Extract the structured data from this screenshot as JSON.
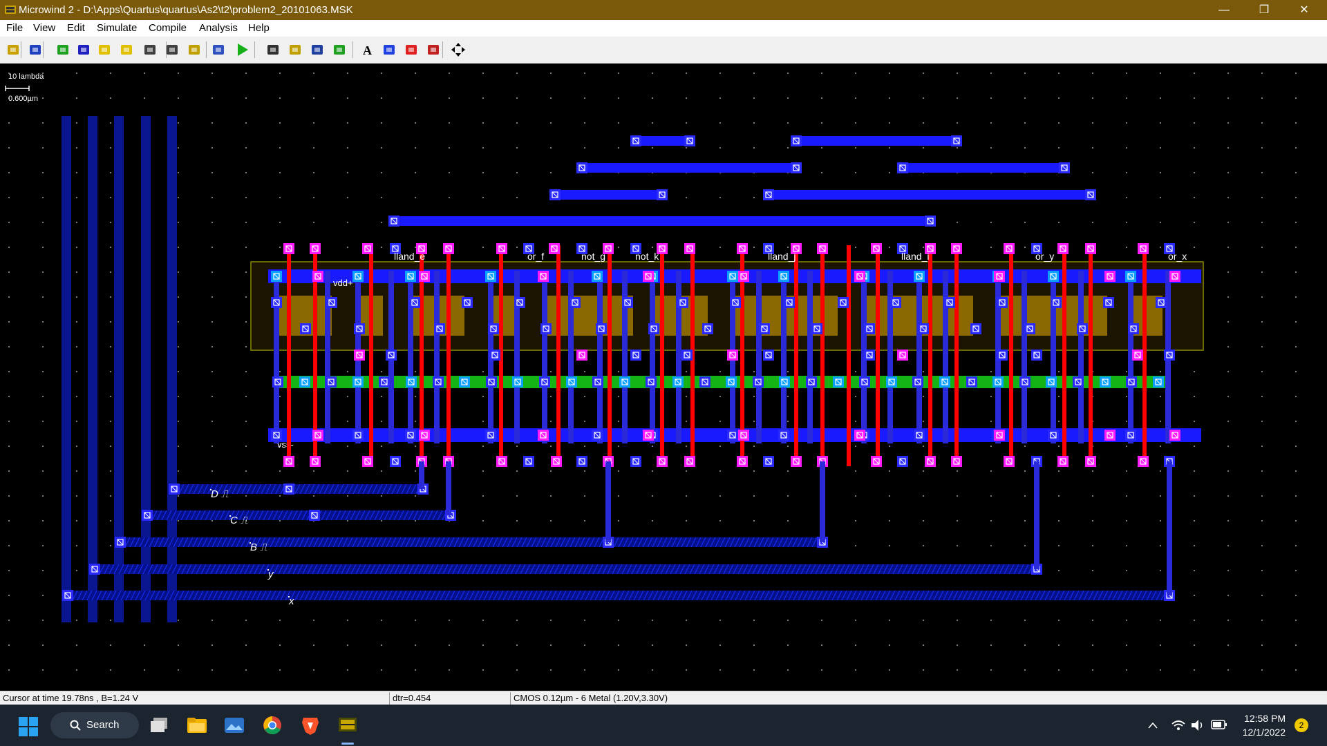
{
  "window": {
    "title": "Microwind 2 - D:\\Apps\\Quartus\\quartus\\As2\\t2\\problem2_20101063.MSK",
    "minimize_glyph": "—",
    "maximize_glyph": "❐",
    "close_glyph": "✕"
  },
  "menu": [
    "File",
    "View",
    "Edit",
    "Simulate",
    "Compile",
    "Analysis",
    "Help"
  ],
  "toolbar_icons": [
    "open-file-icon",
    "save-icon",
    "edit-icon",
    "layer-icon",
    "copy-icon",
    "move-icon",
    "zoom-in-icon",
    "zoom-out-icon",
    "zoom-all-icon",
    "connect-icon",
    "run-simulation-icon",
    "distance-icon",
    "mos-icon",
    "3d-view-icon",
    "chip-icon",
    "text-icon",
    "cross-section-icon",
    "curve-icon",
    "palette-icon",
    "navigate-icon"
  ],
  "scale": {
    "label": "10 lambda",
    "value": "0.600µm"
  },
  "layout": {
    "rail_labels": [
      "vdd+",
      "vss-"
    ],
    "cell_labels": [
      "lland_e",
      "or_f",
      "not_g",
      "not_k",
      "lland_j",
      "lland_i",
      "or_y",
      "or_x"
    ],
    "input_labels": [
      "D",
      "C",
      "B",
      "y",
      "x"
    ]
  },
  "status": {
    "cursor": "Cursor at  time 19.78ns , B=1.24 V",
    "dtr": "dtr=0.454",
    "tech": "CMOS 0.12µm - 6 Metal (1.20V,3.30V)"
  },
  "taskbar": {
    "search": "Search",
    "time": "12:58 PM",
    "date": "12/1/2022",
    "notifications": "2"
  },
  "colors": {
    "metal1": "#1a1aff",
    "metal2_bus": "#0a1590",
    "poly": "#ff0000",
    "contact_pink": "#ff19ff",
    "diff_n": "#0aa0ff",
    "nwell_outline": "#8a8a00",
    "diff_p": "#8a6a00",
    "diff_green": "#14b414",
    "titlebar": "#7a5a0a"
  }
}
